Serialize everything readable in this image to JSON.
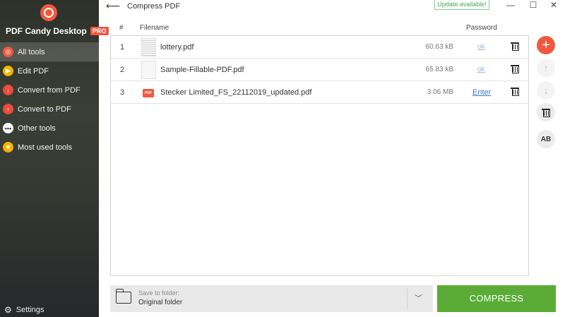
{
  "app": {
    "name": "PDF Candy Desktop",
    "badge": "PRO"
  },
  "sidebar": {
    "items": [
      {
        "label": "All tools",
        "icon": "candy-logo-icon",
        "color": "#f0583e",
        "active": true
      },
      {
        "label": "Edit PDF",
        "icon": "edit-pdf-icon",
        "color": "#f5b400"
      },
      {
        "label": "Convert from PDF",
        "icon": "arrow-down-icon",
        "color": "#ef4b3f"
      },
      {
        "label": "Convert to PDF",
        "icon": "arrow-up-icon",
        "color": "#ef4b3f"
      },
      {
        "label": "Other tools",
        "icon": "more-dots-icon",
        "color": "#ffffff"
      },
      {
        "label": "Most used tools",
        "icon": "star-icon",
        "color": "#f5b400"
      }
    ],
    "settings_label": "Settings"
  },
  "header": {
    "title": "Compress PDF",
    "update_badge": "Update available!"
  },
  "table": {
    "columns": {
      "number": "#",
      "filename": "Filename",
      "password": "Password"
    },
    "rows": [
      {
        "num": "1",
        "filename": "lottery.pdf",
        "size": "60.63 kB",
        "password": "ok",
        "thumb": "document"
      },
      {
        "num": "2",
        "filename": "Sample-Fillable-PDF.pdf",
        "size": "65.83 kB",
        "password": "ok",
        "thumb": "blank"
      },
      {
        "num": "3",
        "filename": "Stecker Limited_FS_22112019_updated.pdf",
        "size": "3.06 MB",
        "password": "Enter",
        "thumb": "pdf-icon"
      }
    ]
  },
  "toolbar": {
    "ab_label": "AB"
  },
  "save": {
    "label": "Save to folder:",
    "value": "Original folder"
  },
  "action": {
    "compress_label": "COMPRESS"
  },
  "colors": {
    "accent": "#f0583e",
    "compress": "#5aac36",
    "update": "#43a857"
  }
}
